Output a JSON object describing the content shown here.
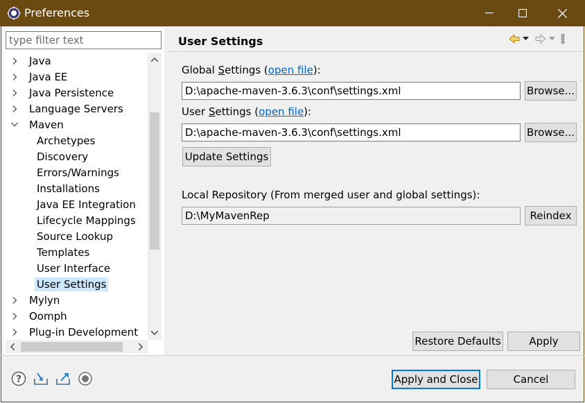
{
  "window": {
    "title": "Preferences",
    "icon": "gear-icon",
    "title_bar_color": "#6b4a12"
  },
  "filter": {
    "placeholder": "type filter text",
    "value": ""
  },
  "tree": {
    "items": [
      {
        "label": "Java",
        "expandable": true,
        "expanded": false,
        "level": 0
      },
      {
        "label": "Java EE",
        "expandable": true,
        "expanded": false,
        "level": 0
      },
      {
        "label": "Java Persistence",
        "expandable": true,
        "expanded": false,
        "level": 0
      },
      {
        "label": "Language Servers",
        "expandable": true,
        "expanded": false,
        "level": 0
      },
      {
        "label": "Maven",
        "expandable": true,
        "expanded": true,
        "level": 0
      },
      {
        "label": "Archetypes",
        "expandable": false,
        "level": 1
      },
      {
        "label": "Discovery",
        "expandable": false,
        "level": 1
      },
      {
        "label": "Errors/Warnings",
        "expandable": false,
        "level": 1
      },
      {
        "label": "Installations",
        "expandable": false,
        "level": 1
      },
      {
        "label": "Java EE Integration",
        "expandable": false,
        "level": 1
      },
      {
        "label": "Lifecycle Mappings",
        "expandable": false,
        "level": 1
      },
      {
        "label": "Source Lookup",
        "expandable": false,
        "level": 1
      },
      {
        "label": "Templates",
        "expandable": false,
        "level": 1
      },
      {
        "label": "User Interface",
        "expandable": false,
        "level": 1
      },
      {
        "label": "User Settings",
        "expandable": false,
        "level": 1,
        "selected": true
      },
      {
        "label": "Mylyn",
        "expandable": true,
        "expanded": false,
        "level": 0
      },
      {
        "label": "Oomph",
        "expandable": true,
        "expanded": false,
        "level": 0
      },
      {
        "label": "Plug-in Development",
        "expandable": true,
        "expanded": false,
        "level": 0
      }
    ]
  },
  "page": {
    "title": "User Settings",
    "global_settings": {
      "label_prefix": "Global ",
      "label_mnemonic": "S",
      "label_rest": "ettings (",
      "link": "open file",
      "label_suffix": "):",
      "value": "D:\\apache-maven-3.6.3\\conf\\settings.xml",
      "browse": "Browse..."
    },
    "user_settings": {
      "label_prefix": "User ",
      "label_mnemonic": "S",
      "label_rest": "ettings (",
      "link": "open file",
      "label_suffix": "):",
      "value": "D:\\apache-maven-3.6.3\\conf\\settings.xml",
      "browse": "Browse..."
    },
    "update_settings": "Update Settings",
    "local_repo": {
      "label": "Local Repository (From merged user and global settings):",
      "value": "D:\\MyMavenRep",
      "reindex": "Reindex"
    },
    "restore_defaults": "Restore Defaults",
    "apply": "Apply"
  },
  "footer": {
    "apply_and_close": "Apply and Close",
    "cancel": "Cancel",
    "icons": [
      "help-icon",
      "import-icon",
      "export-icon",
      "record-icon"
    ]
  },
  "colors": {
    "link": "#0066cc",
    "selection": "#cce8ff",
    "default_button_border": "#0078d7"
  }
}
